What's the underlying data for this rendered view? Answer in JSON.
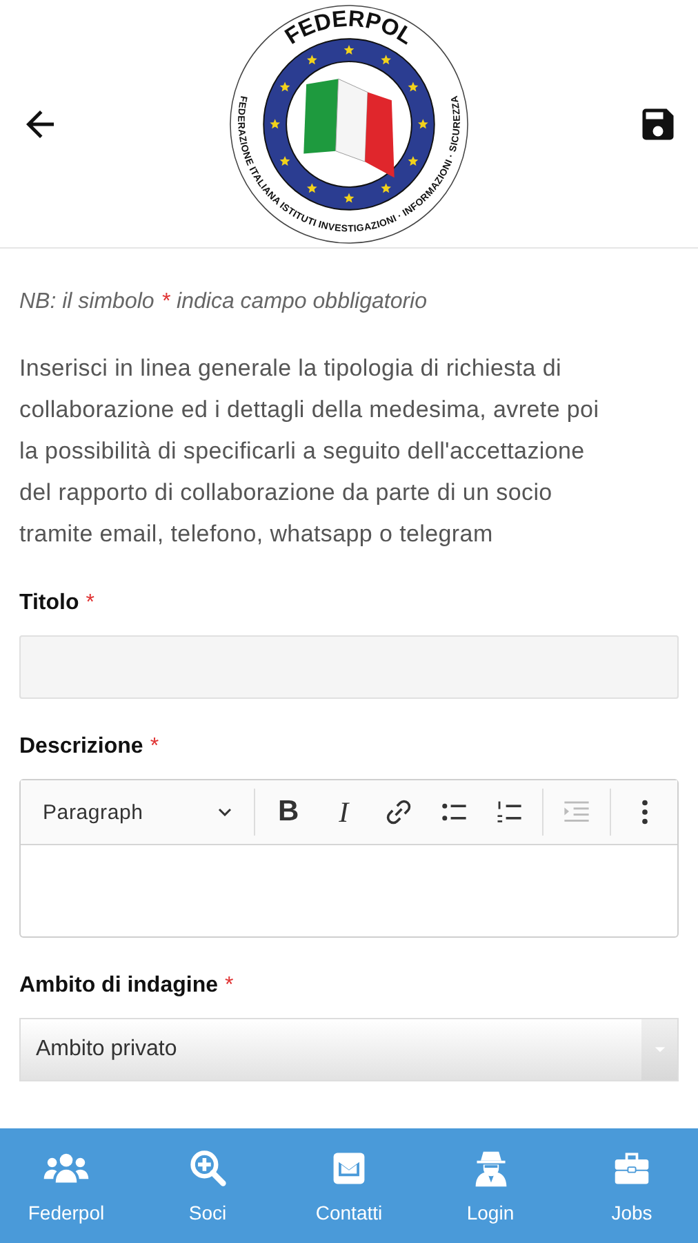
{
  "header": {
    "logo": {
      "title": "FEDERPOL",
      "motto": "FEDERAZIONE ITALIANA ISTITUTI INVESTIGAZIONI · INFORMAZIONI · SICUREZZA"
    }
  },
  "note": {
    "text": "NB: il simbolo",
    "star": "*",
    "rest": "indica campo obbligatorio"
  },
  "intro": "Inserisci in linea generale la tipologia di richiesta di collaborazione ed i dettagli della medesima, avrete poi la possibilità di specificarli a seguito dell'accettazione del rapporto di collaborazione da parte di un socio tramite email, telefono, whatsapp o telegram",
  "fields": [
    {
      "kind": "text",
      "label": "Titolo",
      "required": true
    },
    {
      "kind": "editor",
      "label": "Descrizione",
      "required": true,
      "toolbar": [
        {
          "kind": "dropdown",
          "label": "Paragraph",
          "disabled": false
        },
        {
          "kind": "separator"
        },
        {
          "kind": "bold",
          "label": "B",
          "disabled": false
        },
        {
          "kind": "italic",
          "label": "I",
          "disabled": false
        },
        {
          "kind": "link",
          "disabled": false
        },
        {
          "kind": "bullets",
          "disabled": false
        },
        {
          "kind": "numbers",
          "disabled": false
        },
        {
          "kind": "separator"
        },
        {
          "kind": "indent",
          "disabled": true
        },
        {
          "kind": "separator"
        },
        {
          "kind": "more",
          "disabled": false
        }
      ]
    },
    {
      "kind": "select",
      "label": "Ambito di indagine",
      "required": true,
      "value": "Ambito privato"
    }
  ],
  "nav": [
    {
      "label": "Federpol"
    },
    {
      "label": "Soci"
    },
    {
      "label": "Contatti"
    },
    {
      "label": "Login"
    },
    {
      "label": "Jobs"
    }
  ]
}
